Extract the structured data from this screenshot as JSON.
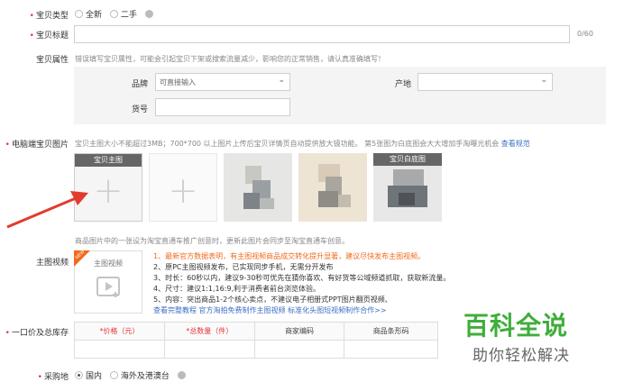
{
  "form": {
    "type_label": "宝贝类型",
    "type_options": [
      "全新",
      "二手"
    ],
    "title_label": "宝贝标题",
    "title_counter": "0/60",
    "attr_label": "宝贝属性",
    "attr_hint": "错误填写宝贝属性，可能会引起宝贝下架或搜索流量减少，影响您的正常销售，请认真准确填写！",
    "brand_label": "品牌",
    "brand_placeholder": "可直接输入",
    "origin_label": "产地",
    "sku_label": "货号",
    "image_label": "电脑端宝贝图片",
    "image_hint": "宝贝主图大小不能超过3MB；700*700 以上图片上传后宝贝详情页自动提供放大镜功能。 第5张图为白底图会大大增加手淘曝光机会",
    "image_link": "查看规范",
    "main_image_caption": "宝贝主图",
    "white_bg_caption": "宝贝白底图",
    "image_note": "商品图片中的一张设为淘宝直通车推广创意时，更新此图片会同步至淘宝直通车创意。",
    "video_label": "主图视频",
    "video_box_label": "主图视频",
    "video_badge": "NEW",
    "video_lines": {
      "l1": "1、最新官方数据表明，有主图视频商品成交转化提升显著，建议尽快发布主图视频。",
      "l2": "2、原PC主图视频发布，已实现同步手机，无需分开发布",
      "l3": "3、时长：60秒以内，建议9-30秒可优先在猜你喜欢、有好货等公域频道抓取，获取新流量。",
      "l4": "4、尺寸：建议1:1,16:9,利于消费者前台浏览体验。",
      "l5": "5、内容：突出商品1-2个核心卖点，不建议电子相册式PPT图片翻页视频、",
      "links": "查看完整教程  官方淘拍免费制作主图视频  标准化头图短视频制作合作>>"
    },
    "price_label": "一口价及总库存",
    "price_headers": [
      "*价格（元）",
      "*总数量（件）",
      "商家编码",
      "商品条形码"
    ],
    "purchase_label": "采购地",
    "purchase_options": [
      "国内",
      "海外及港澳台"
    ]
  },
  "watermark": {
    "title": "百科全说",
    "subtitle": "助你轻松解决"
  },
  "colors": {
    "required": "#e4393c",
    "link": "#3a6fc4",
    "highlight": "#f06a1c",
    "arrow": "#e23b2e",
    "watermark": "#3fae3a"
  }
}
